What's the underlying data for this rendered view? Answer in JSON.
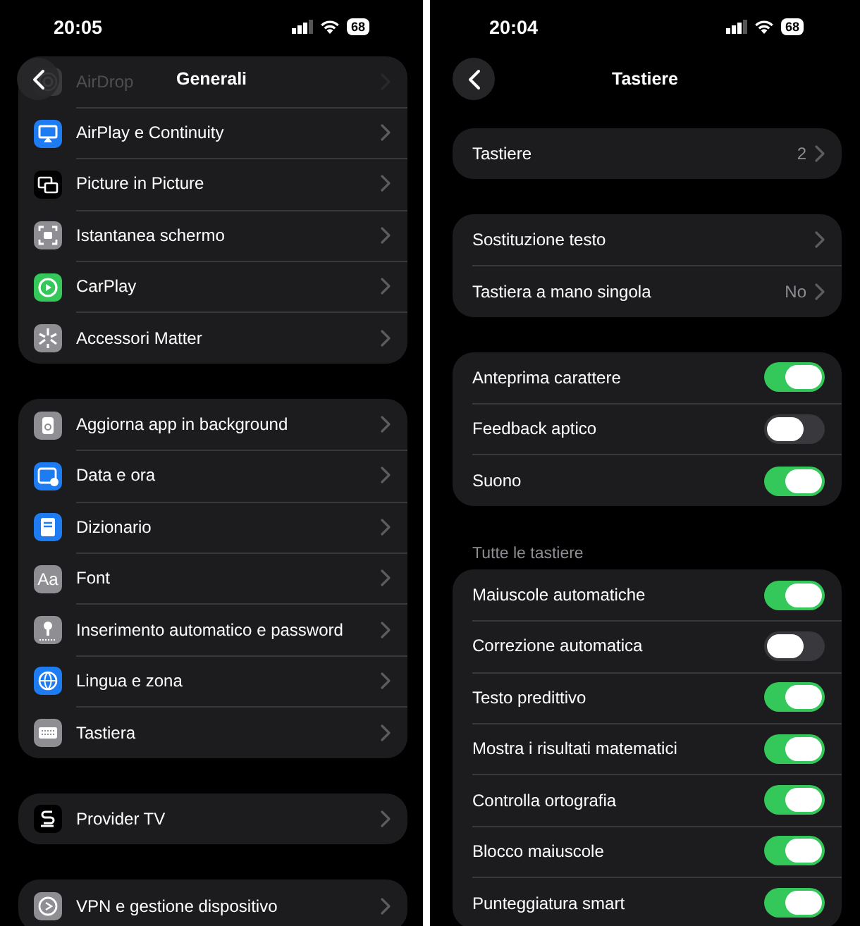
{
  "screens": [
    {
      "status_bar": {
        "time": "20:05",
        "battery": "68"
      },
      "title": "Generali",
      "scrolled": true,
      "groups": [
        {
          "rows": [
            {
              "kind": "link",
              "label": "AirDrop",
              "color": "#3a3a3c",
              "faded": true
            },
            {
              "kind": "link",
              "label": "AirPlay e Continuity",
              "color": "#1e7cf2",
              "faded": false
            },
            {
              "kind": "link",
              "label": "Picture in Picture",
              "color": "#000000",
              "faded": false
            },
            {
              "kind": "link",
              "label": "Istantanea schermo",
              "color": "#8e8e93",
              "faded": false
            },
            {
              "kind": "link",
              "label": "CarPlay",
              "color": "#34c759",
              "faded": false
            },
            {
              "kind": "link",
              "label": "Accessori Matter",
              "color": "#8e8e93",
              "faded": false
            }
          ]
        },
        {
          "rows": [
            {
              "kind": "link",
              "label": "Aggiorna app in background",
              "color": "#8e8e93"
            },
            {
              "kind": "link",
              "label": "Data e ora",
              "color": "#1e7cf2"
            },
            {
              "kind": "link",
              "label": "Dizionario",
              "color": "#1e7cf2"
            },
            {
              "kind": "link",
              "label": "Font",
              "color": "#8e8e93",
              "icon_text": "Aa"
            },
            {
              "kind": "link",
              "label": "Inserimento automatico e password",
              "color": "#8e8e93"
            },
            {
              "kind": "link",
              "label": "Lingua e zona",
              "color": "#1e7cf2"
            },
            {
              "kind": "link",
              "label": "Tastiera",
              "color": "#8e8e93"
            }
          ]
        },
        {
          "rows": [
            {
              "kind": "link",
              "label": "Provider TV",
              "color": "#000000"
            }
          ]
        },
        {
          "rows": [
            {
              "kind": "link",
              "label": "VPN e gestione dispositivo",
              "color": "#8e8e93"
            }
          ]
        }
      ]
    },
    {
      "status_bar": {
        "time": "20:04",
        "battery": "68"
      },
      "title": "Tastiere",
      "scrolled": false,
      "groups": [
        {
          "rows": [
            {
              "kind": "link",
              "label": "Tastiere",
              "value": "2"
            }
          ]
        },
        {
          "rows": [
            {
              "kind": "link",
              "label": "Sostituzione testo"
            },
            {
              "kind": "link",
              "label": "Tastiera a mano singola",
              "value": "No"
            }
          ]
        },
        {
          "rows": [
            {
              "kind": "toggle",
              "label": "Anteprima carattere",
              "on": true
            },
            {
              "kind": "toggle",
              "label": "Feedback aptico",
              "on": false
            },
            {
              "kind": "toggle",
              "label": "Suono",
              "on": true
            }
          ]
        },
        {
          "header": "Tutte le tastiere",
          "rows": [
            {
              "kind": "toggle",
              "label": "Maiuscole automatiche",
              "on": true
            },
            {
              "kind": "toggle",
              "label": "Correzione automatica",
              "on": false
            },
            {
              "kind": "toggle",
              "label": "Testo predittivo",
              "on": true
            },
            {
              "kind": "toggle",
              "label": "Mostra i risultati matematici",
              "on": true
            },
            {
              "kind": "toggle",
              "label": "Controlla ortografia",
              "on": true
            },
            {
              "kind": "toggle",
              "label": "Blocco maiuscole",
              "on": true
            },
            {
              "kind": "toggle",
              "label": "Punteggiatura smart",
              "on": true
            }
          ]
        }
      ]
    }
  ]
}
